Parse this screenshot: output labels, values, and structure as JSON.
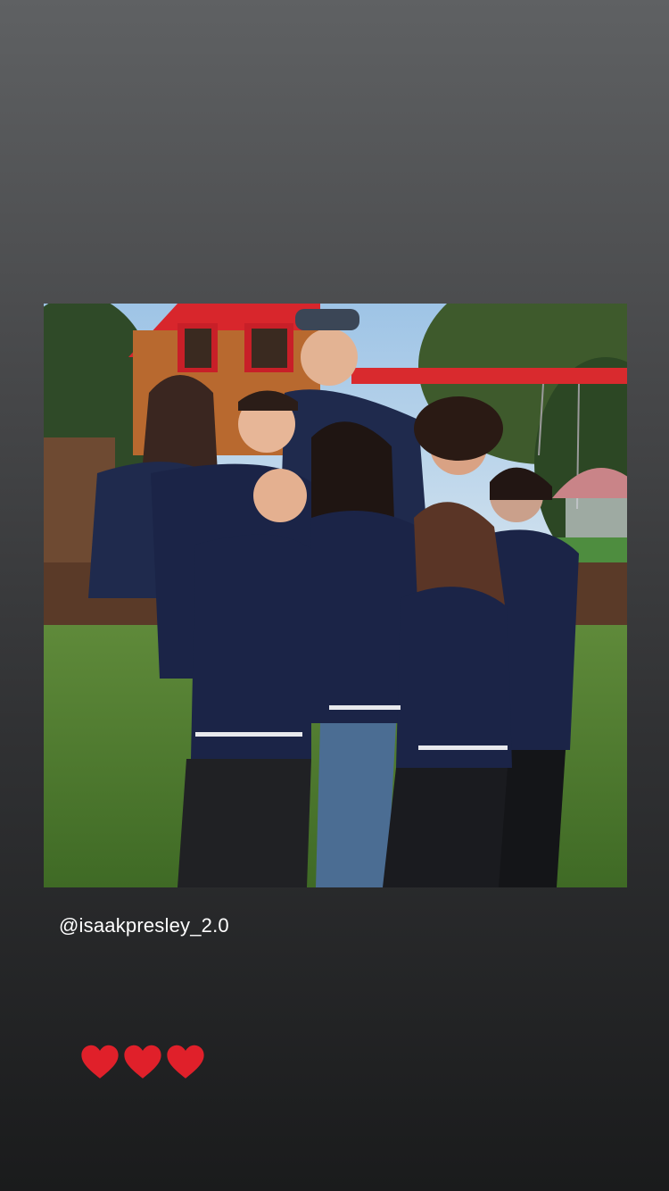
{
  "story": {
    "mention": "@isaakpresley_2.0",
    "sticker_hearts": [
      {
        "icon": "red-heart-icon",
        "color": "#e0202a"
      },
      {
        "icon": "red-heart-icon",
        "color": "#e0202a"
      },
      {
        "icon": "red-heart-icon",
        "color": "#e0202a"
      }
    ],
    "colors": {
      "background_top": "#5f6163",
      "background_bottom": "#1a1b1c",
      "text": "#ffffff",
      "heart": "#e0202a"
    }
  }
}
